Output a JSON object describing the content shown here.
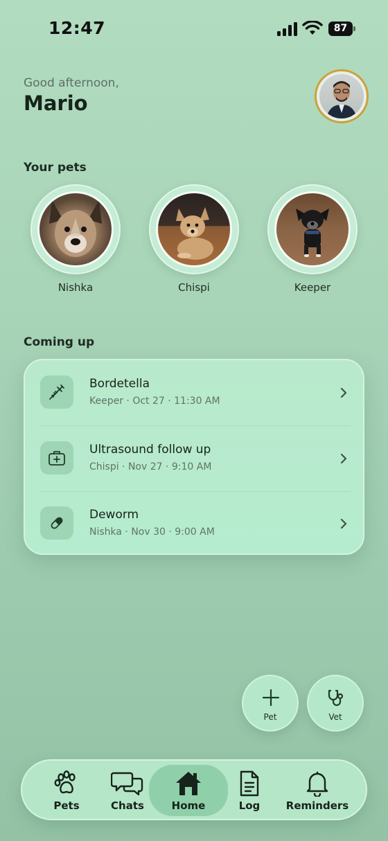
{
  "status_bar": {
    "time": "12:47",
    "battery": "87"
  },
  "header": {
    "greeting": "Good afternoon,",
    "name": "Mario"
  },
  "pets_section": {
    "title": "Your pets",
    "pets": [
      {
        "name": "Nishka"
      },
      {
        "name": "Chispi"
      },
      {
        "name": "Keeper"
      }
    ]
  },
  "upcoming": {
    "title": "Coming up",
    "items": [
      {
        "title": "Bordetella",
        "subtitle": "Keeper · Oct 27 · 11:30 AM",
        "icon": "syringe-icon"
      },
      {
        "title": "Ultrasound follow up",
        "subtitle": "Chispi · Nov 27 · 9:10 AM",
        "icon": "medical-kit-icon"
      },
      {
        "title": "Deworm",
        "subtitle": "Nishka · Nov 30 · 9:00 AM",
        "icon": "pill-icon"
      }
    ]
  },
  "actions": {
    "pet": "Pet",
    "vet": "Vet"
  },
  "tabs": [
    {
      "label": "Pets",
      "icon": "paw-icon"
    },
    {
      "label": "Chats",
      "icon": "chat-bubbles-icon"
    },
    {
      "label": "Home",
      "icon": "home-icon",
      "active": true
    },
    {
      "label": "Log",
      "icon": "document-icon"
    },
    {
      "label": "Reminders",
      "icon": "bell-icon"
    }
  ],
  "colors": {
    "accent": "#8fd0aa",
    "background": "#a8d4b8",
    "avatar_ring": "#c9a23a"
  }
}
